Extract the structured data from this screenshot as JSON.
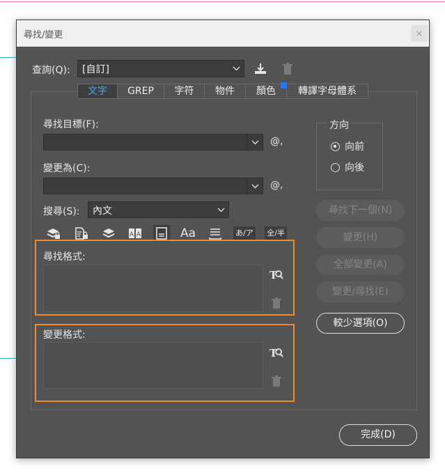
{
  "dialog": {
    "title": "尋找/變更",
    "close_glyph": "×"
  },
  "query": {
    "label": "查詢(Q):",
    "value": "[自訂]"
  },
  "tabs": [
    {
      "label": "文字",
      "active": true
    },
    {
      "label": "GREP",
      "active": false
    },
    {
      "label": "字符",
      "active": false
    },
    {
      "label": "物件",
      "active": false
    },
    {
      "label": "顏色",
      "active": false
    },
    {
      "label": "轉譯字母體系",
      "active": false
    }
  ],
  "find": {
    "label": "尋找目標(F):",
    "value": "",
    "special_glyph": "@,"
  },
  "change": {
    "label": "變更為(C):",
    "value": "",
    "special_glyph": "@,"
  },
  "search": {
    "label": "搜尋(S):",
    "value": "內文"
  },
  "direction": {
    "title": "方向",
    "forward": "向前",
    "backward": "向後",
    "selected": "向前"
  },
  "buttons": {
    "find_next": "尋找下一個(N)",
    "change": "變更(H)",
    "change_all": "全部變更(A)",
    "change_find": "變更/尋找(E)",
    "fewer_options": "較少選項(O)",
    "done": "完成(D)"
  },
  "option_icons": {
    "aa_label": "Aa",
    "kana_label": "あ/ア",
    "width_label": "全/半"
  },
  "find_format": {
    "label": "尋找格式:"
  },
  "change_format": {
    "label": "變更格式:"
  },
  "colors": {
    "dialog_bg": "#535353",
    "highlight": "#f08a2c",
    "active_tab": "#4aa3ff"
  }
}
